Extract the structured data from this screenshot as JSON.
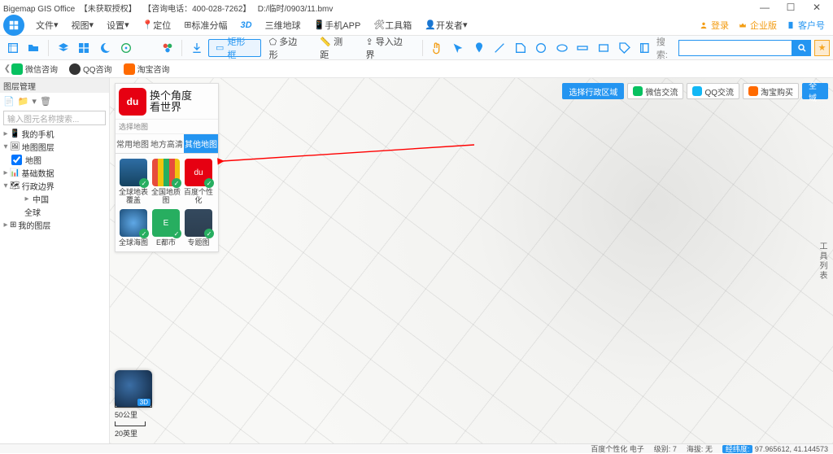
{
  "titlebar": {
    "appName": "Bigemap GIS Office",
    "auth": "【未获取授权】",
    "hotline": "【咨询电话：400-028-7262】",
    "file": "D:/临时/0903/11.bmv"
  },
  "menubar": {
    "items": [
      "文件",
      "视图",
      "设置",
      "定位",
      "标准分幅",
      "3D",
      "三维地球",
      "手机APP",
      "工具箱",
      "开发者"
    ],
    "right": {
      "login": "登录",
      "biz": "企业版",
      "cust": "客户号"
    }
  },
  "toolbar": {
    "pill": "矩形框",
    "textbtns": [
      "多边形",
      "测距",
      "导入边界"
    ],
    "search_label": "搜索:",
    "search_placeholder": ""
  },
  "chatline": {
    "items": [
      {
        "label": "微信咨询",
        "color": "#07c160"
      },
      {
        "label": "QQ咨询",
        "color": "#ff3b30"
      },
      {
        "label": "淘宝咨询",
        "color": "#e67e22"
      }
    ]
  },
  "side": {
    "head": "图层管理",
    "search_placeholder": "输入图元名称搜索...",
    "tree": {
      "my_phone": "我的手机",
      "layers": "地图图层",
      "map_sub": "地图",
      "base": "基础数据",
      "admin": "行政边界",
      "china": "中国",
      "world": "全球",
      "my_layers": "我的图层"
    }
  },
  "selector": {
    "brand": "选择地图",
    "logo_text": "du",
    "slogan_l1": "换个角度",
    "slogan_l2": "看世界",
    "tabs": [
      "常用地图",
      "地方高清",
      "其他地图"
    ],
    "activeTab": 2,
    "cards": [
      {
        "name": "全球地表覆盖",
        "bg": "#1e6aa7"
      },
      {
        "name": "全国地质图",
        "bg": "#d64545"
      },
      {
        "name": "百度个性化",
        "bg": "#e60012",
        "txt": "du"
      },
      {
        "name": "全球海图",
        "bg": "#3478c9"
      },
      {
        "name": "E都市",
        "bg": "#27ae60",
        "txt": "E"
      },
      {
        "name": "专题图",
        "bg": "#34495e"
      }
    ]
  },
  "overlay": {
    "region": "选择行政区域",
    "chips": [
      {
        "label": "微信交流",
        "color": "#07c160"
      },
      {
        "label": "QQ交流",
        "color": "#12b7f5"
      },
      {
        "label": "淘宝购买",
        "color": "#ff6a00"
      }
    ],
    "fullscreen": "全域"
  },
  "rightvbar": "工具列表",
  "scale": {
    "big": "50公里",
    "small": "20英里"
  },
  "globe_tag": "3D",
  "status": {
    "map_mode": "百度个性化 电子",
    "level_label": "级别:",
    "level": "7",
    "alt_label": "海拔:",
    "alt": "无",
    "coord_label": "经纬度:",
    "coord": "97.965612, 41.144573"
  }
}
